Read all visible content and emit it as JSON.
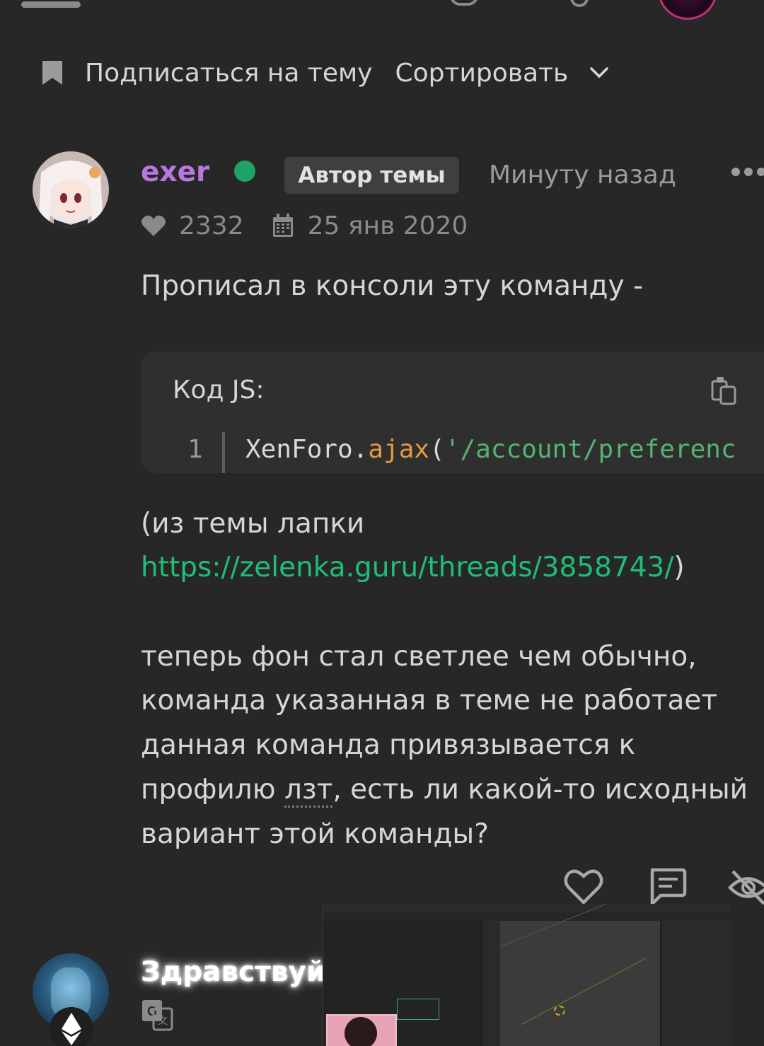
{
  "thread_actions": {
    "subscribe_label": "Подписаться на тему",
    "sort_label": "Сортировать"
  },
  "post": {
    "username": "exer",
    "author_badge": "Автор темы",
    "time": "Минуту назад",
    "likes": "2332",
    "reg_date": "25 янв 2020",
    "text_line1": "Прописал в консоли эту команду -",
    "code_title": "Код JS:",
    "code_line_number": "1",
    "code_tokens": {
      "obj": "XenForo.",
      "fn": "ajax",
      "paren": "(",
      "str": "'/account/preferenc"
    },
    "text_paren_open": "(из темы лапки",
    "link": "https://zelenka.guru/threads/3858743/",
    "text_paren_close": ")",
    "text_line4": "теперь фон стал светлее чем обычно,",
    "text_line5": "команда указанная в теме не работает",
    "text_line6": "данная команда привязывается к",
    "text_line7_a": "профилю ",
    "text_line7_b": "лзт",
    "text_line7_c": ", есть ли какой-то исходный",
    "text_line8": "вариант этой команды?"
  },
  "next_post": {
    "text": "Здравствуйт"
  },
  "colors": {
    "background": "#272727",
    "username": "#b778e0",
    "online": "#1fa467",
    "link": "#1fbd75",
    "code_fn": "#e39b41",
    "code_str": "#56b36f"
  },
  "icons": [
    "bookmark-icon",
    "chevron-down-icon",
    "more-icon",
    "heart-icon",
    "calendar-icon",
    "copy-icon",
    "like-icon",
    "reply-icon",
    "hide-icon",
    "ethereum-icon",
    "translate-icon"
  ]
}
